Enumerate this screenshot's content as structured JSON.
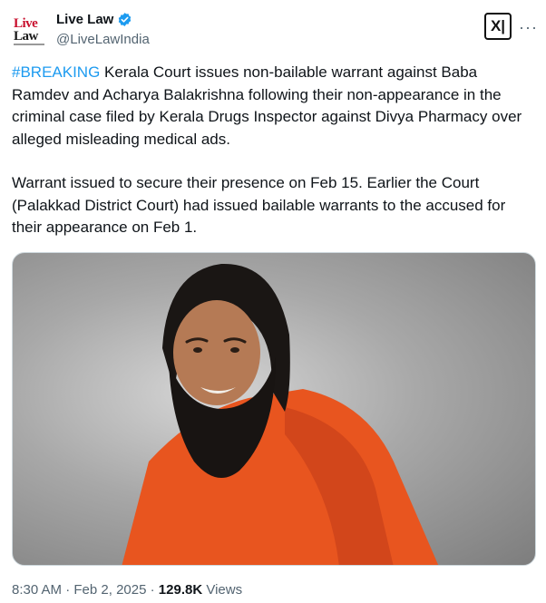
{
  "account": {
    "logo_line1": "Live",
    "logo_line2": "Law",
    "display_name": "Live Law",
    "handle": "@LiveLawIndia"
  },
  "header": {
    "grok_label": "X|",
    "more_label": "···"
  },
  "tweet": {
    "hashtag": "#BREAKING",
    "paragraph1": " Kerala Court issues non-bailable warrant against Baba Ramdev and Acharya Balakrishna following their non-appearance in the criminal case filed by Kerala Drugs Inspector against Divya Pharmacy over alleged misleading medical ads.",
    "paragraph2": "Warrant issued to secure their presence on Feb 15. Earlier the Court (Palakkad District Court) had issued bailable warrants to the accused for their appearance on Feb 1."
  },
  "meta": {
    "time": "8:30 AM",
    "separator": " · ",
    "date": "Feb 2, 2025",
    "views_count": "129.8K",
    "views_label": " Views"
  },
  "colors": {
    "link": "#1d9bf0",
    "verified": "#1d9bf0",
    "robe": "#e8551f"
  }
}
